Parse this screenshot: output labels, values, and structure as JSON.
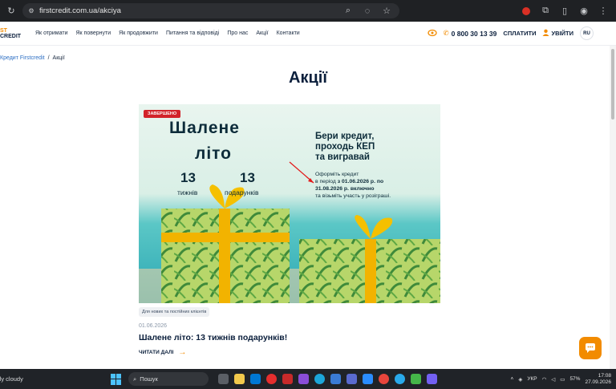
{
  "browser": {
    "url": "firstcredit.com.ua/akciya"
  },
  "header": {
    "logo_line1": "ST",
    "logo_line2": "CREDIT",
    "nav": [
      "Як отримати",
      "Як повернути",
      "Як продовжити",
      "Питання та відповіді",
      "Про нас",
      "Акції",
      "Контакти"
    ],
    "phone": "0 800 30 13 39",
    "pay_label": "СПЛАТИТИ",
    "login_label": "УВІЙТИ",
    "lang": "RU"
  },
  "breadcrumb": {
    "home": "Кредит Firstcredit",
    "separator": "/",
    "current": "Акції"
  },
  "page_title": "Акції",
  "promo": {
    "badge": "ЗАВЕРШЕНО",
    "headline_1": "Шалене",
    "headline_2": "літо",
    "count_weeks": "13",
    "weeks_label": "тижнів",
    "count_gifts": "13",
    "gifts_label": "подарунків",
    "right_title_1": "Бери кредит,",
    "right_title_2": "проходь КЕП",
    "right_title_3": "та вигравай",
    "desc_1": "Оформіть кредит",
    "desc_2a": "в період ",
    "desc_2b": "з 01.06.2026 р. по",
    "desc_3": "31.08.2026 р. включно",
    "desc_4": "та візьміть участь у розіграші.",
    "tag": "Для нових та постійних клієнтів",
    "date": "01.06.2026",
    "title": "Шалене літо: 13 тижнів подарунків!",
    "read_more": "ЧИТАТИ ДАЛІ"
  },
  "taskbar": {
    "weather": "lly cloudy",
    "search": "Пошук",
    "lang": "УКР",
    "battery": "57%",
    "time": "17:08",
    "date": "27.09.2026"
  },
  "colors": {
    "accent": "#f28b00",
    "navy": "#0b1f3c",
    "badge": "#d2232a"
  }
}
